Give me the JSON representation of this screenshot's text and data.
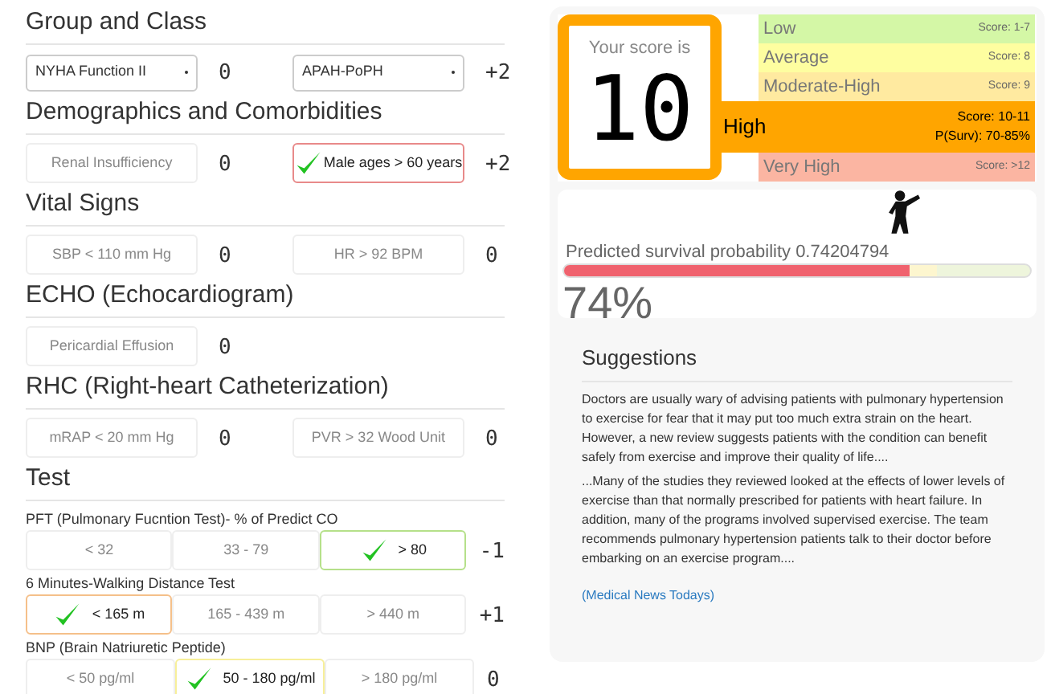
{
  "sections": [
    {
      "title": "Group and Class",
      "rows": [
        {
          "kind": "pair",
          "items": [
            {
              "kind": "select",
              "label": "NYHA Function II",
              "points": "0"
            },
            {
              "kind": "select",
              "label": "APAH-PoPH",
              "points": "+2"
            }
          ]
        }
      ]
    },
    {
      "title": "Demographics and Comorbidities",
      "rows": [
        {
          "kind": "pair",
          "items": [
            {
              "kind": "toggle",
              "label": "Renal Insufficiency",
              "checked": false,
              "points": "0"
            },
            {
              "kind": "toggle",
              "label": "Male ages > 60 years",
              "checked": true,
              "color": "#e88a8a",
              "points": "+2"
            }
          ]
        }
      ]
    },
    {
      "title": "Vital Signs",
      "rows": [
        {
          "kind": "pair",
          "items": [
            {
              "kind": "toggle",
              "label": "SBP < 110 mm Hg",
              "checked": false,
              "points": "0"
            },
            {
              "kind": "toggle",
              "label": "HR > 92 BPM",
              "checked": false,
              "points": "0"
            }
          ]
        }
      ]
    },
    {
      "title": "ECHO (Echocardiogram)",
      "rows": [
        {
          "kind": "pair",
          "items": [
            {
              "kind": "toggle",
              "label": "Pericardial Effusion",
              "checked": false,
              "points": "0"
            }
          ]
        }
      ]
    },
    {
      "title": "RHC (Right-heart Catheterization)",
      "rows": [
        {
          "kind": "pair",
          "items": [
            {
              "kind": "toggle",
              "label": "mRAP < 20 mm Hg",
              "checked": false,
              "points": "0"
            },
            {
              "kind": "toggle",
              "label": "PVR > 32 Wood Unit",
              "checked": false,
              "points": "0"
            }
          ]
        }
      ]
    },
    {
      "title": "Test",
      "rows": [
        {
          "kind": "options",
          "label": "PFT (Pulmonary Fucntion Test)- % of Predict CO",
          "points": "-1",
          "options": [
            {
              "label": "< 32",
              "checked": false
            },
            {
              "label": "33 - 79",
              "checked": false
            },
            {
              "label": "> 80",
              "checked": true,
              "color": "#b5e08a"
            }
          ]
        },
        {
          "kind": "options",
          "label": "6 Minutes-Walking Distance Test",
          "points": "+1",
          "options": [
            {
              "label": "< 165 m",
              "checked": true,
              "color": "#f5c08a"
            },
            {
              "label": "165 - 439 m",
              "checked": false
            },
            {
              "label": "> 440 m",
              "checked": false
            }
          ]
        },
        {
          "kind": "options",
          "label": "BNP (Brain Natriuretic Peptide)",
          "points": "0",
          "options": [
            {
              "label": "< 50 pg/ml",
              "checked": false
            },
            {
              "label": "50 - 180 pg/ml",
              "checked": true,
              "color": "#f7ef9a"
            },
            {
              "label": "> 180 pg/ml",
              "checked": false
            }
          ]
        }
      ]
    }
  ],
  "score": {
    "caption": "Your score is",
    "value": "10"
  },
  "risk_levels": [
    {
      "label": "Low",
      "score": "Score: 1-7",
      "selected": false,
      "color": "#d4f7a6"
    },
    {
      "label": "Average",
      "score": "Score: 8",
      "selected": false,
      "color": "#fefea0"
    },
    {
      "label": "Moderate-High",
      "score": "Score: 9",
      "selected": false,
      "color": "#ffeaa0"
    },
    {
      "label": "High",
      "score": "Score: 10-11",
      "survival": "P(Surv): 70-85%",
      "selected": true,
      "color": "#ffa500"
    },
    {
      "label": "Very High",
      "score": "Score: >12",
      "selected": false,
      "color": "#fbb5a2"
    }
  ],
  "survival": {
    "text": "Predicted survival probability 0.74204794",
    "level": 0.742,
    "percent": "74%"
  },
  "suggestions": {
    "title": "Suggestions",
    "paragraphs": [
      "Doctors are usually wary of advising patients with pulmonary hypertension to exercise for fear that it may put too much extra strain on the heart. However, a new review suggests patients with the condition can benefit safely from exercise and improve their quality of life....",
      "...Many of the studies they reviewed looked at the effects of lower levels of exercise than that normally prescribed for patients with heart failure. In addition, many of the programs involved supervised exercise. The team recommends pulmonary hypertension patients talk to their doctor before embarking on an exercise program...."
    ],
    "link": "(Medical News Todays)"
  }
}
